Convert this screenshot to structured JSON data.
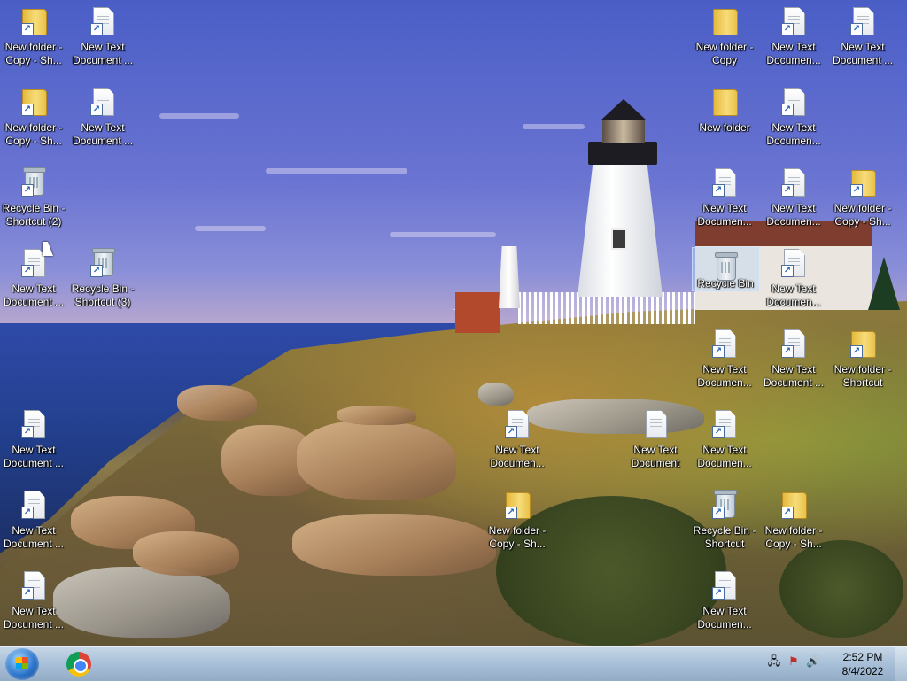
{
  "desktop": {
    "icons": [
      {
        "label": "New folder - Copy - Sh...",
        "type": "folder",
        "shortcut": true
      },
      {
        "label": "New Text Document ...",
        "type": "doc",
        "shortcut": true
      },
      {
        "label": "New folder - Copy - Sh...",
        "type": "folder",
        "shortcut": true
      },
      {
        "label": "New Text Document ...",
        "type": "doc",
        "shortcut": true
      },
      {
        "label": "Recycle Bin - Shortcut (2)",
        "type": "bin",
        "shortcut": true
      },
      {
        "label": "New Text Document ...",
        "type": "doc",
        "shortcut": true
      },
      {
        "label": "Recycle Bin - Shortcut (3)",
        "type": "bin",
        "shortcut": true
      },
      {
        "label": "New Text Document ...",
        "type": "doc",
        "shortcut": true
      },
      {
        "label": "New Text Document ...",
        "type": "doc",
        "shortcut": true
      },
      {
        "label": "New Text Document ...",
        "type": "doc",
        "shortcut": true
      },
      {
        "label": "New Text Documen...",
        "type": "doc",
        "shortcut": true
      },
      {
        "label": "New folder - Copy - Sh...",
        "type": "folder",
        "shortcut": true
      },
      {
        "label": "New Text Document",
        "type": "doc",
        "shortcut": false
      },
      {
        "label": "New folder - Copy",
        "type": "folder",
        "shortcut": false
      },
      {
        "label": "New Text Documen...",
        "type": "doc",
        "shortcut": true
      },
      {
        "label": "New Text Document ...",
        "type": "doc",
        "shortcut": true
      },
      {
        "label": "New folder",
        "type": "folder",
        "shortcut": false
      },
      {
        "label": "New Text Documen...",
        "type": "doc",
        "shortcut": true
      },
      {
        "label": "New Text Documen...",
        "type": "doc",
        "shortcut": true
      },
      {
        "label": "New Text Documen...",
        "type": "doc",
        "shortcut": true
      },
      {
        "label": "New folder - Copy - Sh...",
        "type": "folder",
        "shortcut": true
      },
      {
        "label": "Recycle Bin",
        "type": "bin",
        "shortcut": false,
        "selected": true
      },
      {
        "label": "New Text Documen...",
        "type": "doc",
        "shortcut": true
      },
      {
        "label": "New Text Documen...",
        "type": "doc",
        "shortcut": true
      },
      {
        "label": "New Text Document ...",
        "type": "doc",
        "shortcut": true
      },
      {
        "label": "New folder - Shortcut",
        "type": "folder",
        "shortcut": true
      },
      {
        "label": "New Text Documen...",
        "type": "doc",
        "shortcut": true
      },
      {
        "label": "Recycle Bin - Shortcut",
        "type": "bin",
        "shortcut": true
      },
      {
        "label": "New folder - Copy - Sh...",
        "type": "folder",
        "shortcut": true
      },
      {
        "label": "New Text Documen...",
        "type": "doc",
        "shortcut": true
      }
    ]
  },
  "taskbar": {
    "start_button": "windows-start-orb",
    "pinned": [
      {
        "name": "Google Chrome",
        "icon": "chrome-icon"
      }
    ],
    "tray_icons": [
      "network-icon",
      "action-center-flag-icon",
      "volume-icon"
    ],
    "clock_time": "2:52 PM",
    "clock_date": "8/4/2022"
  }
}
